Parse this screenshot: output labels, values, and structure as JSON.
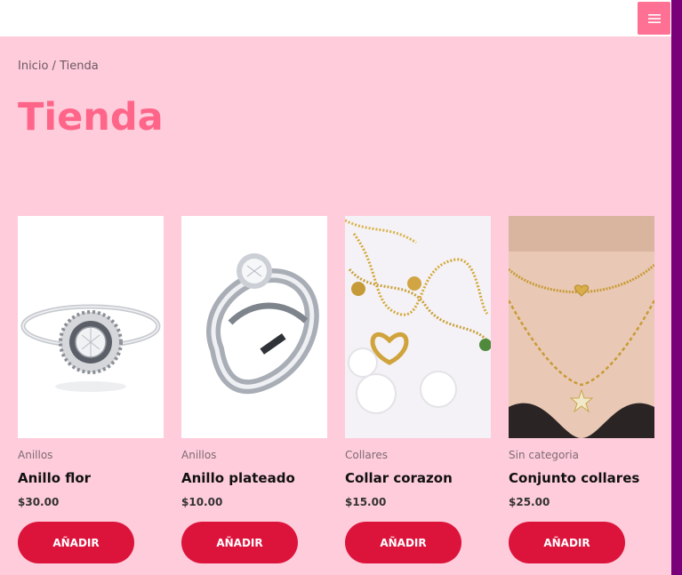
{
  "breadcrumb": {
    "home": "Inicio",
    "separator": "/",
    "current": "Tienda"
  },
  "page_title": "Tienda",
  "colors": {
    "brand_pink": "#fe6589",
    "button_red": "#dc143c",
    "background": "#ffccdb"
  },
  "products": [
    {
      "category": "Anillos",
      "name": "Anillo flor",
      "price": "$30.00",
      "button": "AÑADIR",
      "image": "ring-flower-image"
    },
    {
      "category": "Anillos",
      "name": "Anillo plateado",
      "price": "$10.00",
      "button": "AÑADIR",
      "image": "ring-silver-image"
    },
    {
      "category": "Collares",
      "name": "Collar corazon",
      "price": "$15.00",
      "button": "AÑADIR",
      "image": "heart-necklace-image"
    },
    {
      "category": "Sin categoria",
      "name": "Conjunto collares",
      "price": "$25.00",
      "button": "AÑADIR",
      "image": "necklace-set-image"
    }
  ]
}
